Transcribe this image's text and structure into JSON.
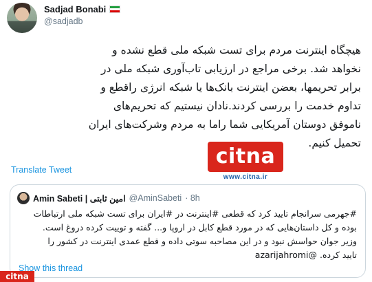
{
  "author": {
    "display_name": "Sadjad Bonabi",
    "handle": "@sadjadb",
    "flag_colors": [
      "#239f40",
      "#ffffff",
      "#da0000"
    ]
  },
  "tweet": {
    "lines": [
      "هیچگاه اینترنت مردم برای تست شبکه ملی قطع نشده و",
      "نخواهد شد. برخی مراجع در ارزیابی تاب‌آوری شبکه ملی در",
      "برابر تحریمها، بعضن اینترنت بانک‌ها یا شبکه انرژی راقطع و",
      "تداوم خدمت را بررسی کردند.نادان نیستیم که تحریم‌های",
      "ناموفق دوستان آمریکایی شما راما به مردم وشرکت‌های ایران",
      "تحمیل کنیم."
    ],
    "translate_label": "Translate Tweet"
  },
  "watermark": {
    "logo_text": "citna",
    "url": "www.citna.ir",
    "corner_text": "citna",
    "brand_color": "#d9261c"
  },
  "quoted": {
    "name": "Amin Sabeti | امین ثابتی",
    "handle": "@AminSabeti",
    "time": "· 8h",
    "lines": [
      "#جهرمی سرانجام تایید کرد که قطعی #اینترنت در #ایران برای تست شبکه ملی ارتباطات",
      "بوده و کل داستان‌هایی که در مورد قطع کابل در اروپا و... گفته و توییت کرده دروغ است.",
      "وزیر جوان حواسش نبود و در این مصاحبه سوتی داده و قطع عمدی اینترنت در کشور را",
      "تایید کرده. @azarijahromi"
    ],
    "show_thread": "Show this thread"
  },
  "colors": {
    "link": "#1b95e0",
    "muted": "#657786",
    "border": "#ccd6dd"
  }
}
